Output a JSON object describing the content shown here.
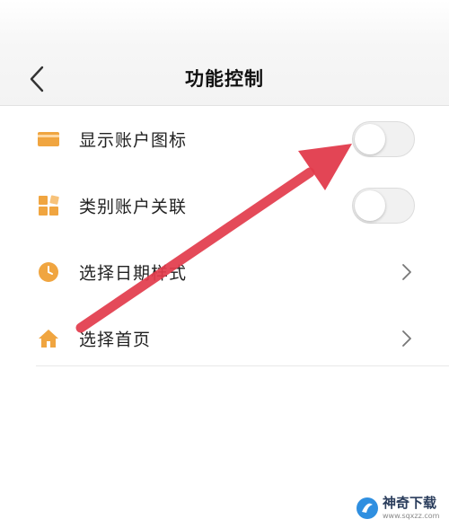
{
  "header": {
    "title": "功能控制",
    "back_icon": "chevron-left-icon"
  },
  "items": [
    {
      "label": "显示账户图标",
      "icon": "card-icon",
      "control": "toggle",
      "enabled": false
    },
    {
      "label": "类别账户关联",
      "icon": "grid-icon",
      "control": "toggle",
      "enabled": false
    },
    {
      "label": "选择日期样式",
      "icon": "clock-icon",
      "control": "chevron"
    },
    {
      "label": "选择首页",
      "icon": "home-icon",
      "control": "chevron"
    }
  ],
  "colors": {
    "icon": "#f0a540",
    "arrow": "#e23b4c",
    "toggle_off": "#f1f1f1"
  },
  "watermark": {
    "name": "神奇下载",
    "url": "www.sqxzz.com"
  }
}
